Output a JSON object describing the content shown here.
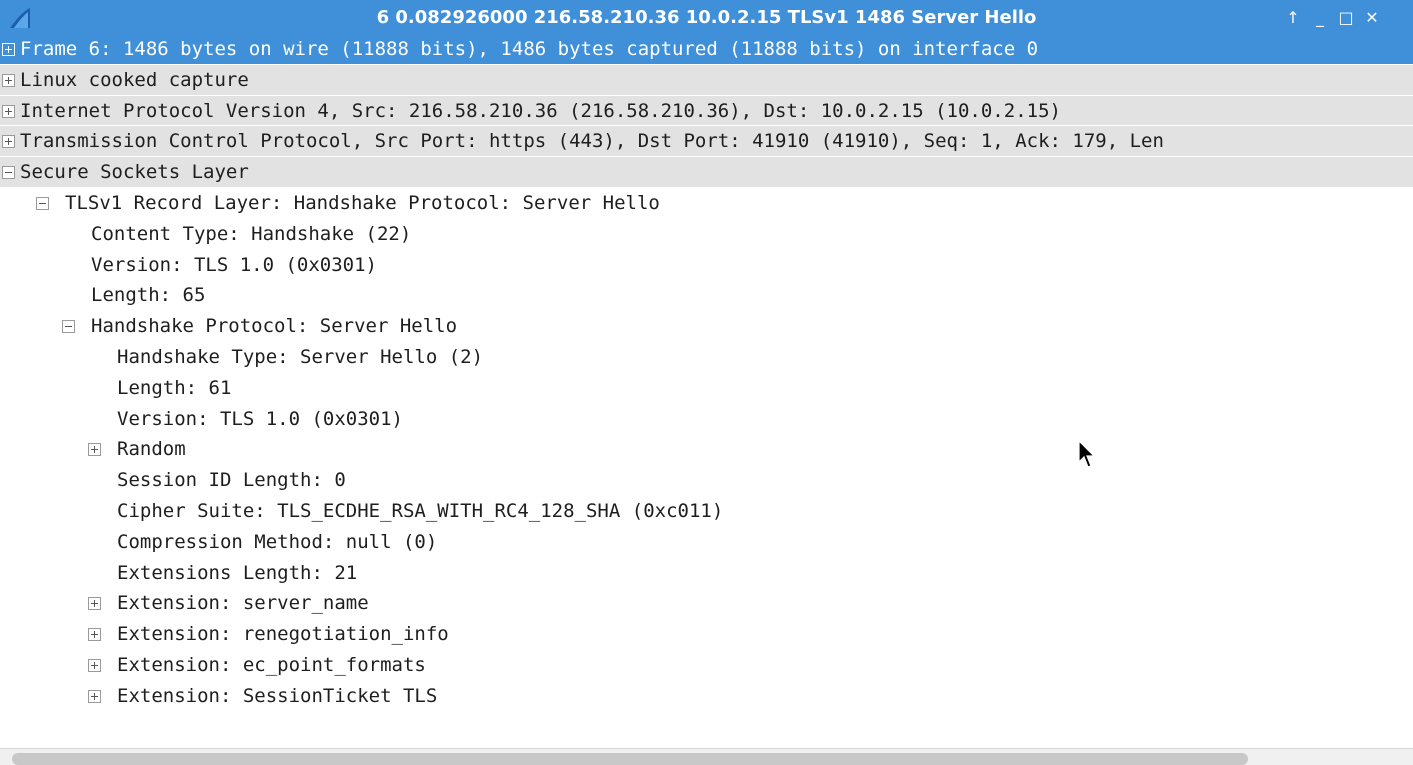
{
  "window": {
    "title": "6 0.082926000 216.58.210.36 10.0.2.15 TLSv1 1486 Server Hello",
    "buttons": {
      "up": "↑",
      "minimize": "_",
      "maximize": "□",
      "close": "✕"
    }
  },
  "tree": {
    "rows": [
      {
        "label": "Frame 6: 1486 bytes on wire (11888 bits), 1486 bytes captured (11888 bits) on interface 0"
      },
      {
        "label": "Linux cooked capture"
      },
      {
        "label": "Internet Protocol Version 4, Src: 216.58.210.36 (216.58.210.36), Dst: 10.0.2.15 (10.0.2.15)"
      },
      {
        "label": "Transmission Control Protocol, Src Port: https (443), Dst Port: 41910 (41910), Seq: 1, Ack: 179, Len"
      },
      {
        "label": "Secure Sockets Layer"
      },
      {
        "label": "TLSv1 Record Layer: Handshake Protocol: Server Hello"
      },
      {
        "label": "Content Type: Handshake (22)"
      },
      {
        "label": "Version: TLS 1.0 (0x0301)"
      },
      {
        "label": "Length: 65"
      },
      {
        "label": "Handshake Protocol: Server Hello"
      },
      {
        "label": "Handshake Type: Server Hello (2)"
      },
      {
        "label": "Length: 61"
      },
      {
        "label": "Version: TLS 1.0 (0x0301)"
      },
      {
        "label": "Random"
      },
      {
        "label": "Session ID Length: 0"
      },
      {
        "label": "Cipher Suite: TLS_ECDHE_RSA_WITH_RC4_128_SHA (0xc011)"
      },
      {
        "label": "Compression Method: null (0)"
      },
      {
        "label": "Extensions Length: 21"
      },
      {
        "label": "Extension: server_name"
      },
      {
        "label": "Extension: renegotiation_info"
      },
      {
        "label": "Extension: ec_point_formats"
      },
      {
        "label": "Extension: SessionTicket TLS"
      }
    ]
  },
  "colors": {
    "selection": "#3f8fd9",
    "top_level_row": "#e2e2e2",
    "text": "#1e1e1e"
  },
  "icons": [
    "wireshark-fin-icon",
    "expand-icon",
    "collapse-icon",
    "mouse-pointer-icon"
  ]
}
